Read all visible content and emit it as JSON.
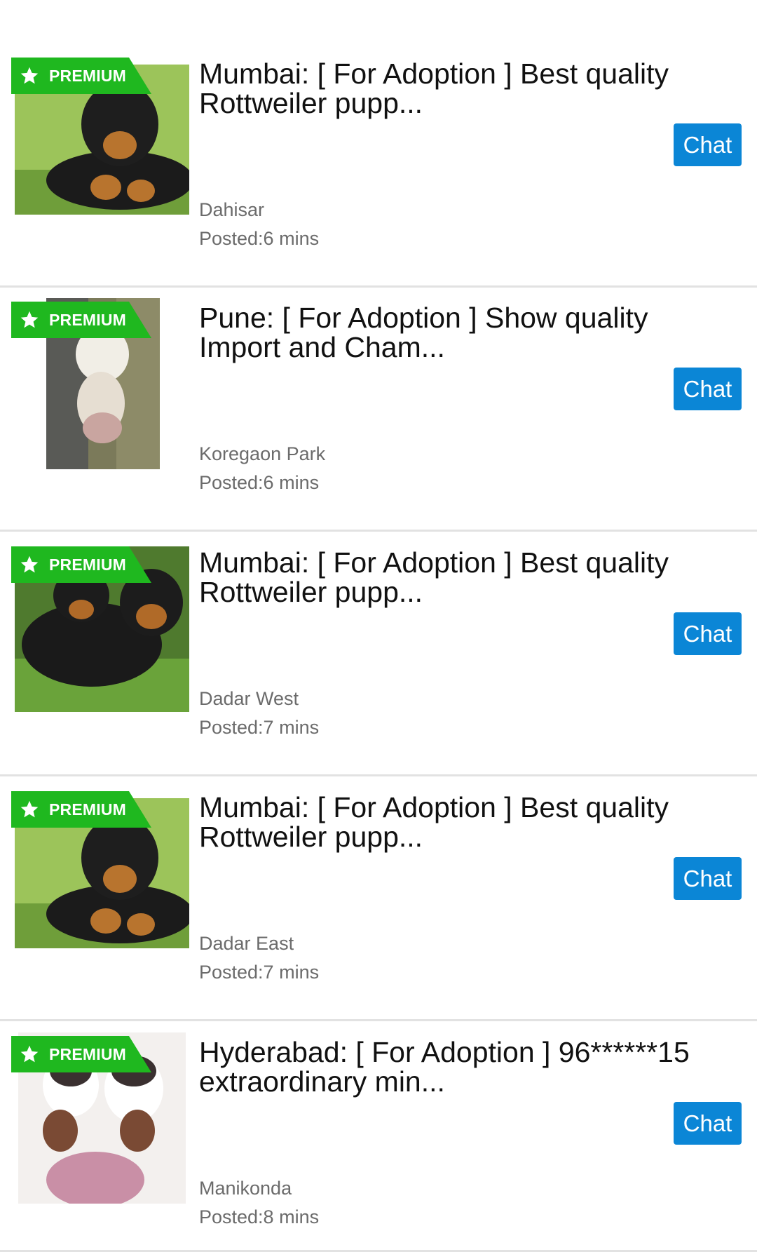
{
  "badge_label": "PREMIUM",
  "chat_label": "Chat",
  "colors": {
    "badge_green": "#1fb81f",
    "chat_blue": "#0b86d6",
    "meta_gray": "#6b6b6b"
  },
  "listings": [
    {
      "title": "Mumbai: [ For Adoption ] Best quality Rottweiler pupp...",
      "location": "Dahisar",
      "posted": "Posted:6 mins",
      "thumbnail": "rottweiler-puppy-photo"
    },
    {
      "title": "Pune: [ For Adoption ] Show quality Import and Cham...",
      "location": "Koregaon Park",
      "posted": "Posted:6 mins",
      "thumbnail": "white-puppy-photo"
    },
    {
      "title": "Mumbai: [ For Adoption ] Best quality Rottweiler pupp...",
      "location": "Dadar West",
      "posted": "Posted:7 mins",
      "thumbnail": "two-rottweiler-puppies-photo"
    },
    {
      "title": "Mumbai: [ For Adoption ] Best quality Rottweiler pupp...",
      "location": "Dadar East",
      "posted": "Posted:7 mins",
      "thumbnail": "rottweiler-puppy-photo"
    },
    {
      "title": "Hyderabad: [ For Adoption ] 96******15 extraordinary min...",
      "location": "Manikonda",
      "posted": "Posted:8 mins",
      "thumbnail": "husky-puppies-photo"
    }
  ]
}
